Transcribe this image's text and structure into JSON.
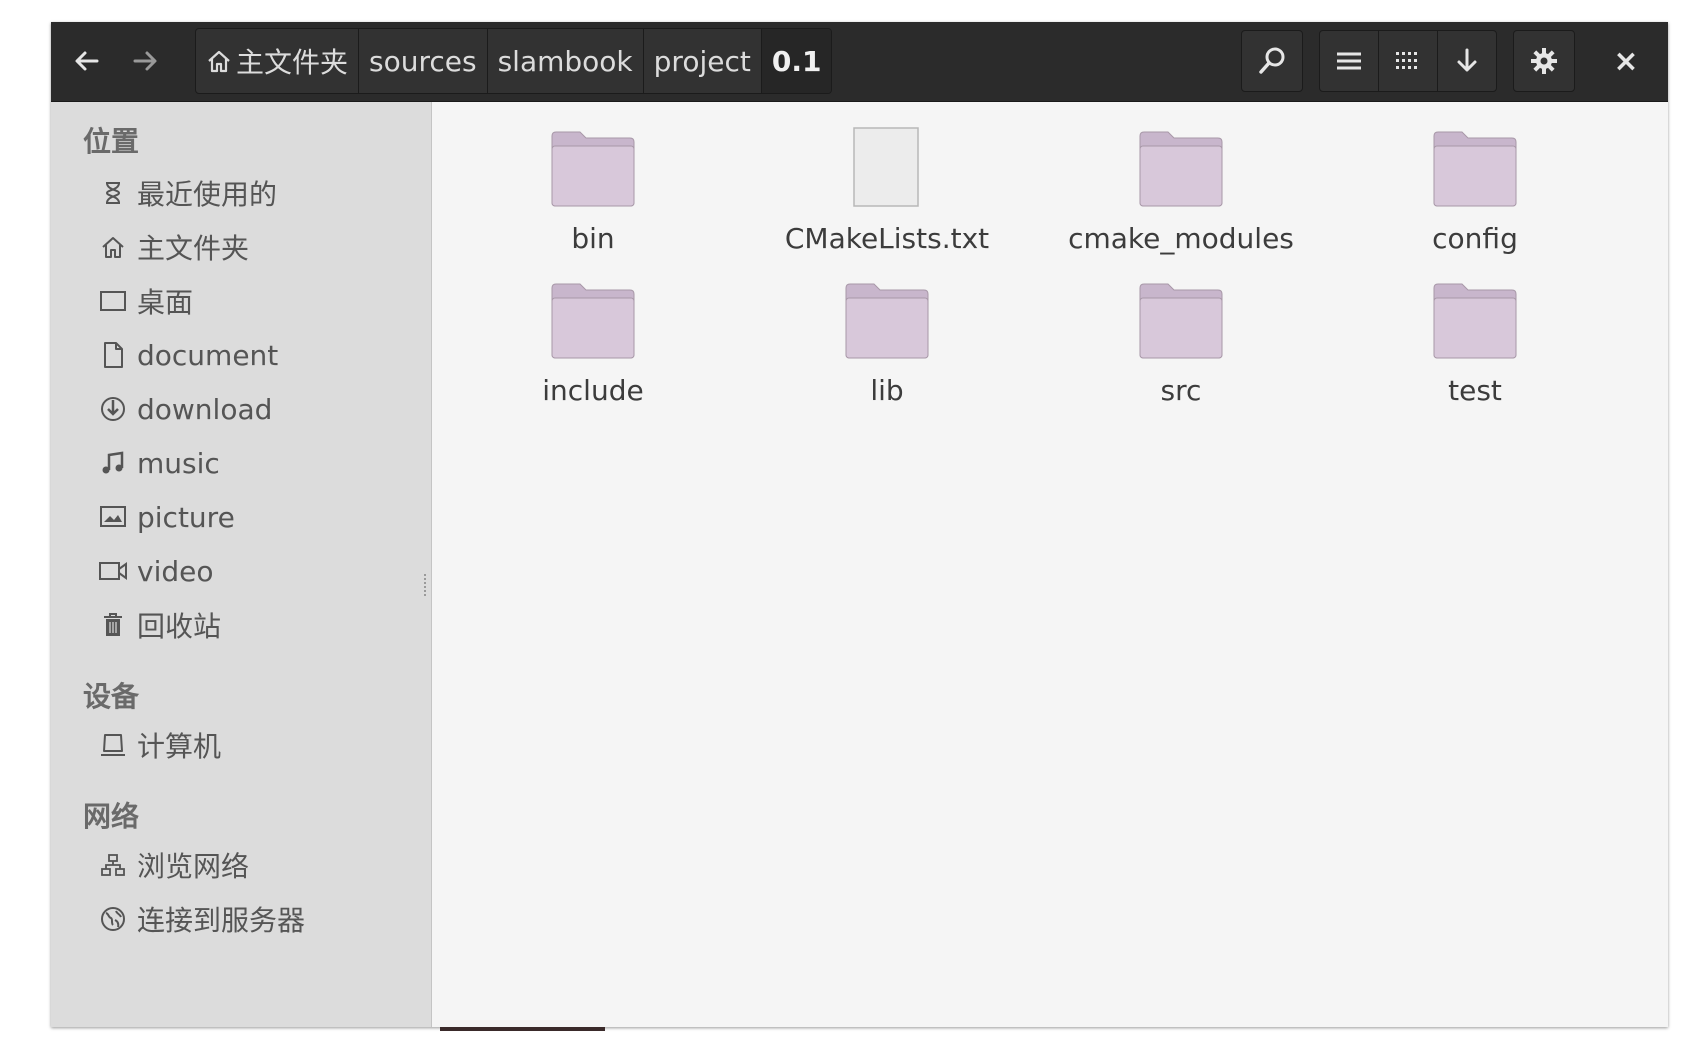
{
  "colors": {
    "headerbar": "#2b2b2b",
    "sidebar": "#dcdcdc",
    "content": "#f5f5f5",
    "folder_fill": "#d8c8da",
    "folder_tab": "#c8b6cc"
  },
  "nav": {
    "back_icon": "arrow-left-icon",
    "forward_icon": "arrow-right-icon"
  },
  "breadcrumb": {
    "items": [
      {
        "label": "主文件夹",
        "icon": "home-icon"
      },
      {
        "label": "sources"
      },
      {
        "label": "slambook"
      },
      {
        "label": "project"
      },
      {
        "label": "0.1",
        "current": true
      }
    ]
  },
  "toolbar": {
    "search_icon": "search-icon",
    "list_view_icon": "list-view-icon",
    "grid_view_icon": "grid-view-icon",
    "download_icon": "download-arrow-icon",
    "settings_icon": "gear-icon",
    "close_label": "×"
  },
  "sidebar": {
    "places_heading": "位置",
    "places": [
      {
        "label": "最近使用的",
        "icon": "hourglass-icon"
      },
      {
        "label": "主文件夹",
        "icon": "home-icon"
      },
      {
        "label": "桌面",
        "icon": "desktop-icon"
      },
      {
        "label": "document",
        "icon": "document-icon"
      },
      {
        "label": "download",
        "icon": "download-icon"
      },
      {
        "label": "music",
        "icon": "music-icon"
      },
      {
        "label": "picture",
        "icon": "picture-icon"
      },
      {
        "label": "video",
        "icon": "video-icon"
      },
      {
        "label": "回收站",
        "icon": "trash-icon"
      }
    ],
    "devices_heading": "设备",
    "devices": [
      {
        "label": "计算机",
        "icon": "computer-icon"
      }
    ],
    "network_heading": "网络",
    "network": [
      {
        "label": "浏览网络",
        "icon": "network-icon"
      },
      {
        "label": "连接到服务器",
        "icon": "globe-icon"
      }
    ]
  },
  "files": [
    {
      "name": "bin",
      "type": "folder"
    },
    {
      "name": "CMakeLists.txt",
      "type": "file"
    },
    {
      "name": "cmake_modules",
      "type": "folder"
    },
    {
      "name": "config",
      "type": "folder"
    },
    {
      "name": "include",
      "type": "folder"
    },
    {
      "name": "lib",
      "type": "folder"
    },
    {
      "name": "src",
      "type": "folder"
    },
    {
      "name": "test",
      "type": "folder"
    }
  ]
}
